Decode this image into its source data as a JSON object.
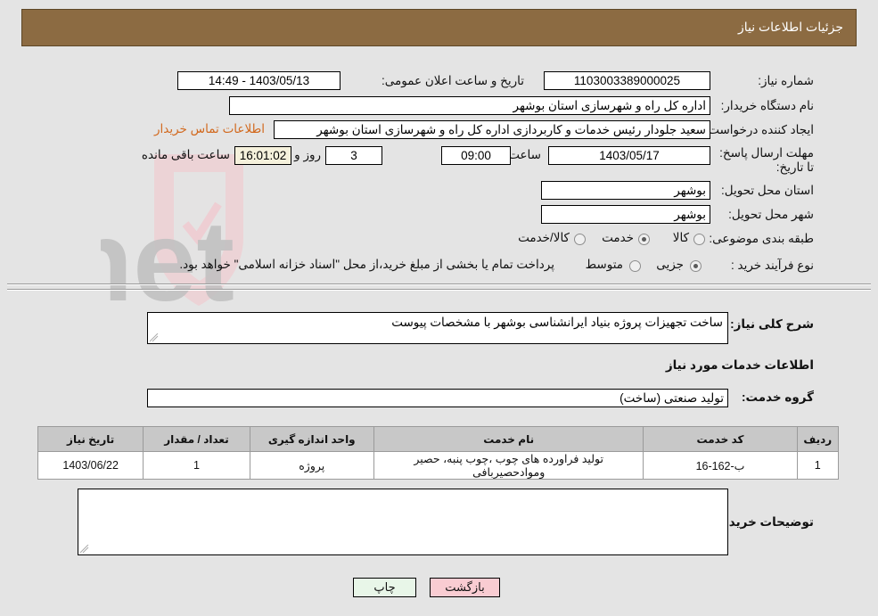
{
  "header": {
    "title": "جزئیات اطلاعات نیاز"
  },
  "watermark": {
    "text": "AriaTender.net"
  },
  "form": {
    "need_number_label": "شماره نیاز:",
    "need_number_value": "1103003389000025",
    "announce_label": "تاریخ و ساعت اعلان عمومی:",
    "announce_value": "1403/05/13 - 14:49",
    "buyer_org_label": "نام دستگاه خریدار:",
    "buyer_org_value": "اداره کل راه و شهرسازی استان بوشهر",
    "creator_label": "ایجاد کننده درخواست:",
    "creator_value": "سعید جلودار رئیس خدمات و کاربردازی اداره کل راه و شهرسازی استان بوشهر",
    "contact_link": "اطلاعات تماس خریدار",
    "deadline_label": "مهلت ارسال پاسخ: تا تاریخ:",
    "deadline_date": "1403/05/17",
    "time_label": "ساعت",
    "deadline_time": "09:00",
    "days_value": "3",
    "days_label": "روز و",
    "countdown_value": "16:01:02",
    "remaining_label": "ساعت باقی مانده",
    "province_label": "استان محل تحویل:",
    "province_value": "بوشهر",
    "city_label": "شهر محل تحویل:",
    "city_value": "بوشهر",
    "category_label": "طبقه بندی موضوعی:",
    "category_options": [
      "کالا",
      "خدمت",
      "کالا/خدمت"
    ],
    "category_selected": "خدمت",
    "process_label": "نوع فرآیند خرید :",
    "process_options": [
      "جزیی",
      "متوسط"
    ],
    "process_selected": "جزیی",
    "payment_note": "پرداخت تمام یا بخشی از مبلغ خرید،از محل \"اسناد خزانه اسلامی\" خواهد بود."
  },
  "summary": {
    "label": "شرح کلی نیاز:",
    "value": "ساخت تجهیزات پروژه بنیاد ایرانشناسی بوشهر  با مشخصات پیوست"
  },
  "services": {
    "section_title": "اطلاعات خدمات مورد نیاز",
    "group_label": "گروه خدمت:",
    "group_value": "تولید صنعتی (ساخت)",
    "columns": [
      "ردیف",
      "کد خدمت",
      "نام خدمت",
      "واحد اندازه گیری",
      "تعداد / مقدار",
      "تاریخ نیاز"
    ],
    "rows": [
      {
        "row": "1",
        "code": "ب-162-16",
        "name": "تولید فراورده های چوب ،چوب پنبه، حصیر وموادحصیربافی",
        "unit": "پروژه",
        "qty": "1",
        "date": "1403/06/22"
      }
    ]
  },
  "buyer_notes": {
    "label": "توضیحات خریدار:",
    "value": ""
  },
  "footer": {
    "print_label": "چاپ",
    "back_label": "بازگشت"
  }
}
